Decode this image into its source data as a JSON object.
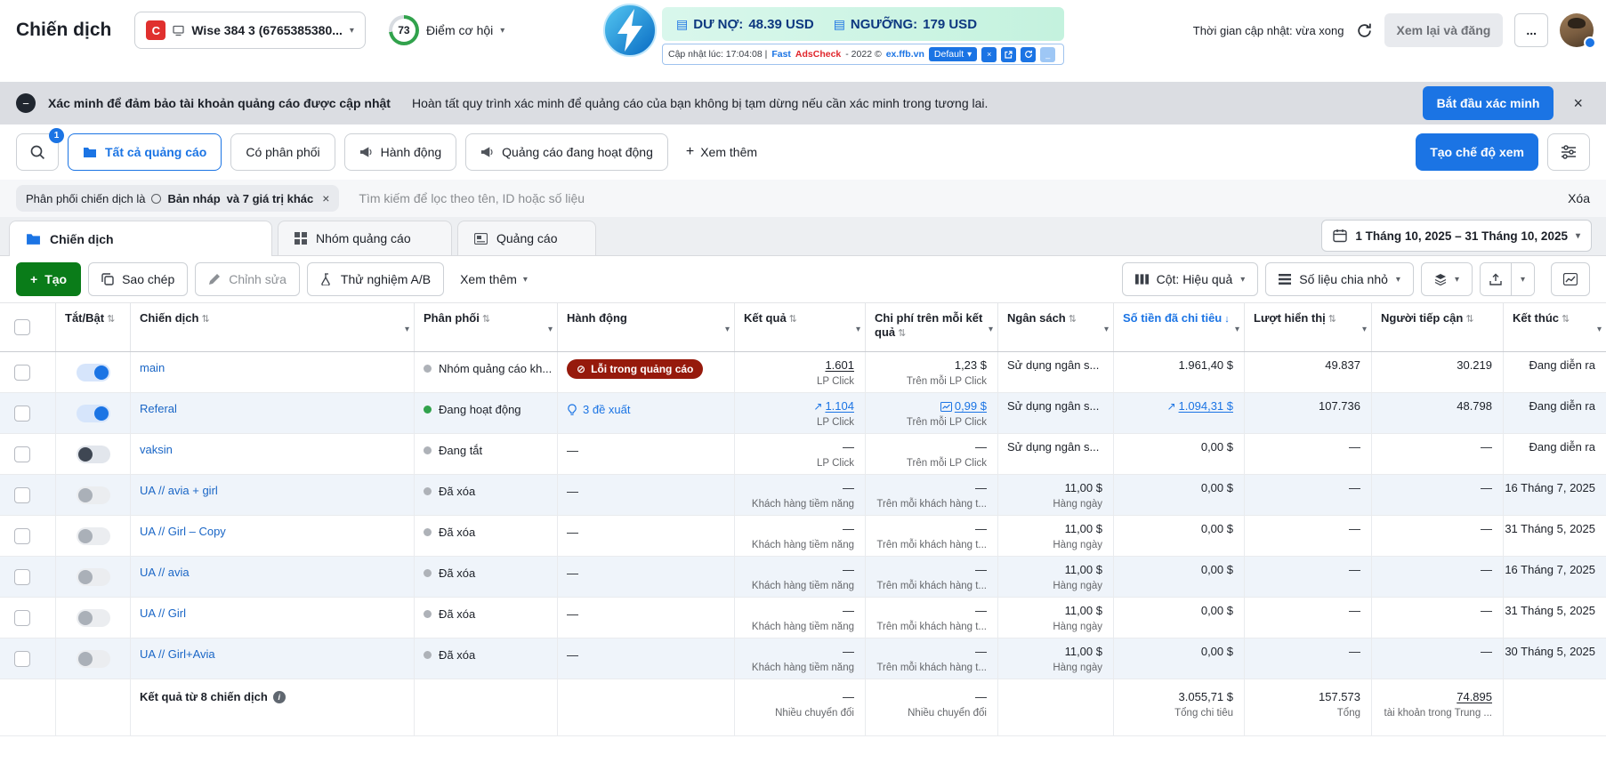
{
  "icons": {
    "caret_down": "▾",
    "sort_both": "⇅",
    "sort_desc": "↓",
    "trend_up": "↗",
    "error": "⊘",
    "close": "×",
    "plus": "+",
    "info": "i",
    "bill": "▤",
    "minus": "−",
    "minimize": "_"
  },
  "colors": {
    "accent": "#1b74e4",
    "create_green": "#0a7c19",
    "error_badge": "#961a0c",
    "active_dot": "#31a24c"
  },
  "header": {
    "title": "Chiến dịch",
    "account": {
      "initial": "C",
      "name": "Wise 384 3 (6765385380..."
    },
    "opportunity": {
      "score": "73",
      "label": "Điểm cơ hội"
    },
    "balance": {
      "debt_label": "DƯ NỢ:",
      "debt_value": "48.39 USD",
      "threshold_label": "NGƯỠNG:",
      "threshold_value": "179 USD"
    },
    "adscheck": {
      "updated": "Cập nhật lúc: 17:04:08 |",
      "brand_fast": "Fast",
      "brand_check": "AdsCheck",
      "year": "- 2022 ©",
      "domain": "ex.ffb.vn",
      "default_label": "Default"
    },
    "update_time": "Thời gian cập nhật: vừa xong",
    "review_button": "Xem lại và đăng",
    "more_button": "..."
  },
  "banner": {
    "title": "Xác minh để đảm bảo tài khoản quảng cáo được cập nhật",
    "description": "Hoàn tất quy trình xác minh để quảng cáo của bạn không bị tạm dừng nếu cần xác minh trong tương lai.",
    "cta": "Bắt đầu xác minh"
  },
  "filters": {
    "search_badge": "1",
    "tabs": [
      "Tất cả quảng cáo",
      "Có phân phối",
      "Hành động",
      "Quảng cáo đang hoạt động"
    ],
    "see_more": "Xem thêm",
    "create_view": "Tạo chế độ xem"
  },
  "chip_row": {
    "prefix": "Phân phối chiến dịch là",
    "value": "Bản nháp",
    "suffix": "và 7 giá trị khác",
    "search_placeholder": "Tìm kiếm để lọc theo tên, ID hoặc số liệu",
    "clear": "Xóa"
  },
  "level_tabs": {
    "campaign": "Chiến dịch",
    "adset": "Nhóm quảng cáo",
    "ad": "Quảng cáo"
  },
  "date_range": "1 Tháng 10, 2025 – 31 Tháng 10, 2025",
  "toolbar": {
    "create": "Tạo",
    "duplicate": "Sao chép",
    "edit": "Chỉnh sửa",
    "ab_test": "Thử nghiệm A/B",
    "more": "Xem thêm",
    "columns": "Cột: Hiệu quả",
    "breakdown": "Số liệu chia nhỏ"
  },
  "table": {
    "columns": [
      {
        "label": "Tắt/Bật"
      },
      {
        "label": "Chiến dịch"
      },
      {
        "label": "Phân phối"
      },
      {
        "label": "Hành động"
      },
      {
        "label": "Kết quả"
      },
      {
        "label": "Chi phí trên mỗi kết quả"
      },
      {
        "label": "Ngân sách"
      },
      {
        "label": "Số tiền đã chi tiêu"
      },
      {
        "label": "Lượt hiển thị"
      },
      {
        "label": "Người tiếp cận"
      },
      {
        "label": "Kết thúc"
      }
    ],
    "rows": [
      {
        "name": "main",
        "toggle": "on",
        "delivery": "Nhóm quảng cáo kh...",
        "delivery_color": "gray",
        "action_type": "error",
        "action_label": "Lỗi trong quảng cáo",
        "result": "1.601",
        "result_sub": "LP Click",
        "result_style": "underline-dark",
        "cpr": "1,23 $",
        "cpr_sub": "Trên mỗi LP Click",
        "budget": "Sử dụng ngân s...",
        "budget_left": true,
        "spent": "1.961,40 $",
        "impressions": "49.837",
        "reach": "30.219",
        "end": "Đang diễn ra"
      },
      {
        "name": "Referal",
        "toggle": "on",
        "delivery": "Đang hoạt động",
        "delivery_color": "green",
        "action_type": "suggestion",
        "action_label": "3 đề xuất",
        "result": "1.104",
        "result_sub": "LP Click",
        "result_style": "trend-link",
        "cpr": "0,99 $",
        "cpr_sub": "Trên mỗi LP Click",
        "cpr_style": "chart-link",
        "budget": "Sử dụng ngân s...",
        "budget_left": true,
        "spent": "1.094,31 $",
        "spent_style": "trend-link",
        "impressions": "107.736",
        "reach": "48.798",
        "end": "Đang diễn ra"
      },
      {
        "name": "vaksin",
        "toggle": "off-dark",
        "delivery": "Đang tắt",
        "delivery_color": "gray",
        "action_type": "none",
        "action_dash": "—",
        "result": "—",
        "result_sub": "LP Click",
        "cpr": "—",
        "cpr_sub": "Trên mỗi LP Click",
        "budget": "Sử dụng ngân s...",
        "budget_left": true,
        "spent": "0,00 $",
        "impressions": "—",
        "reach": "—",
        "end": "Đang diễn ra"
      },
      {
        "name": "UA // avia + girl",
        "toggle": "off",
        "delivery": "Đã xóa",
        "delivery_color": "gray",
        "action_type": "none",
        "action_dash": "—",
        "result": "—",
        "result_sub": "Khách hàng tiềm năng",
        "cpr": "—",
        "cpr_sub": "Trên mỗi khách hàng t...",
        "budget": "11,00 $",
        "budget_sub": "Hàng ngày",
        "spent": "0,00 $",
        "impressions": "—",
        "reach": "—",
        "end": "16 Tháng 7, 2025"
      },
      {
        "name": "UA // Girl – Copy",
        "toggle": "off",
        "delivery": "Đã xóa",
        "delivery_color": "gray",
        "action_type": "none",
        "action_dash": "—",
        "result": "—",
        "result_sub": "Khách hàng tiềm năng",
        "cpr": "—",
        "cpr_sub": "Trên mỗi khách hàng t...",
        "budget": "11,00 $",
        "budget_sub": "Hàng ngày",
        "spent": "0,00 $",
        "impressions": "—",
        "reach": "—",
        "end": "31 Tháng 5, 2025"
      },
      {
        "name": "UA // avia",
        "toggle": "off",
        "delivery": "Đã xóa",
        "delivery_color": "gray",
        "action_type": "none",
        "action_dash": "—",
        "result": "—",
        "result_sub": "Khách hàng tiềm năng",
        "cpr": "—",
        "cpr_sub": "Trên mỗi khách hàng t...",
        "budget": "11,00 $",
        "budget_sub": "Hàng ngày",
        "spent": "0,00 $",
        "impressions": "—",
        "reach": "—",
        "end": "16 Tháng 7, 2025"
      },
      {
        "name": "UA // Girl",
        "toggle": "off",
        "delivery": "Đã xóa",
        "delivery_color": "gray",
        "action_type": "none",
        "action_dash": "—",
        "result": "—",
        "result_sub": "Khách hàng tiềm năng",
        "cpr": "—",
        "cpr_sub": "Trên mỗi khách hàng t...",
        "budget": "11,00 $",
        "budget_sub": "Hàng ngày",
        "spent": "0,00 $",
        "impressions": "—",
        "reach": "—",
        "end": "31 Tháng 5, 2025"
      },
      {
        "name": "UA // Girl+Avia",
        "toggle": "off",
        "delivery": "Đã xóa",
        "delivery_color": "gray",
        "action_type": "none",
        "action_dash": "—",
        "result": "—",
        "result_sub": "Khách hàng tiềm năng",
        "cpr": "—",
        "cpr_sub": "Trên mỗi khách hàng t...",
        "budget": "11,00 $",
        "budget_sub": "Hàng ngày",
        "spent": "0,00 $",
        "impressions": "—",
        "reach": "—",
        "end": "30 Tháng 5, 2025"
      }
    ],
    "footer": {
      "label": "Kết quả từ 8 chiến dịch",
      "result": "—",
      "result_sub": "Nhiều chuyển đổi",
      "cpr": "—",
      "cpr_sub": "Nhiều chuyển đổi",
      "spent": "3.055,71 $",
      "spent_sub": "Tổng chi tiêu",
      "impressions": "157.573",
      "impressions_sub": "Tổng",
      "reach": "74.895",
      "reach_sub": "tài khoản trong Trung ..."
    }
  }
}
